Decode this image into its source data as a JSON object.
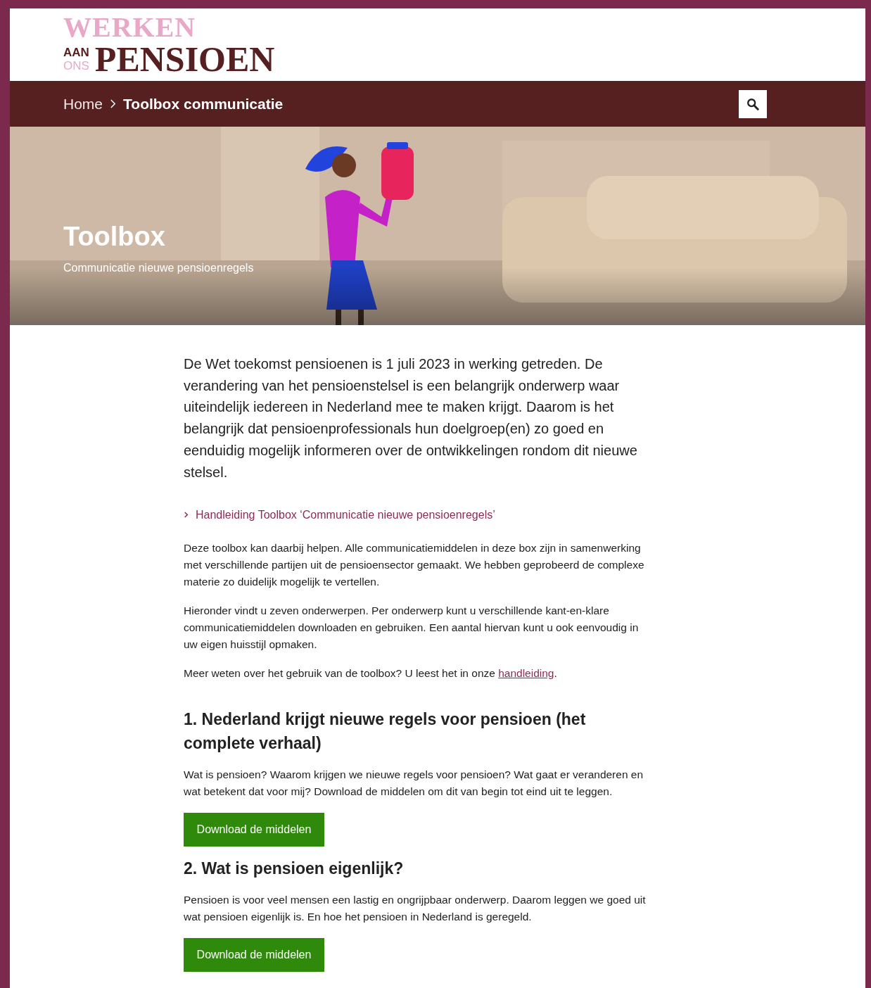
{
  "logo": {
    "line1": "WERKEN",
    "small_top": "AAN",
    "small_bottom": "ONS",
    "line2": "PENSIOEN"
  },
  "breadcrumb": [
    {
      "label": "Home",
      "current": false
    },
    {
      "label": "Toolbox communicatie",
      "current": true
    }
  ],
  "hero": {
    "kind": "picture",
    "title": "Toolbox",
    "subtitle": "Communicatie nieuwe pensioenregels"
  },
  "intro": "De Wet toekomst pensioenen is 1 juli 2023 in werking getreden. De verandering van het pensioenstelsel is een belangrijk onderwerp waar uiteindelijk iedereen in Nederland mee te maken krijgt. Daarom is het belangrijk dat pensioenprofessionals hun doelgroep(en) zo goed en eenduidig mogelijk informeren over de ontwikkelingen rondom dit nieuwe stelsel.",
  "guide_link": "Handleiding Toolbox ‘Communicatie nieuwe pensioenregels’",
  "paragraphs": [
    "Deze toolbox kan daarbij helpen. Alle communicatiemiddelen in deze box zijn in samenwerking met verschillende partijen uit de pensioensector gemaakt. We hebben geprobeerd de complexe materie zo duidelijk mogelijk te vertellen.",
    "Hieronder vindt u zeven onderwerpen. Per onderwerp kunt u verschillende kant-en-klare communicatiemiddelen downloaden en gebruiken. Een aantal hiervan kunt u ook eenvoudig in uw eigen huisstijl opmaken."
  ],
  "more": {
    "before": "Meer weten over het gebruik van de toolbox? U leest het in onze ",
    "link": "handleiding",
    "after": "."
  },
  "topics": [
    {
      "title": "1. Nederland krijgt nieuwe regels voor pensioen (het complete verhaal)",
      "text": "Wat is pensioen? Waarom krijgen we nieuwe regels voor pensioen? Wat gaat er veranderen en wat betekent dat voor mij? Download de middelen om dit van begin tot eind uit te leggen.",
      "button": "Download de middelen"
    },
    {
      "title": "2. Wat is pensioen eigenlijk?",
      "text": "Pensioen is voor veel mensen een lastig en ongrijpbaar onderwerp. Daarom leggen we goed uit wat pensioen eigenlijk is. En hoe het pensioen in Nederland is geregeld.",
      "button": "Download de middelen"
    }
  ]
}
